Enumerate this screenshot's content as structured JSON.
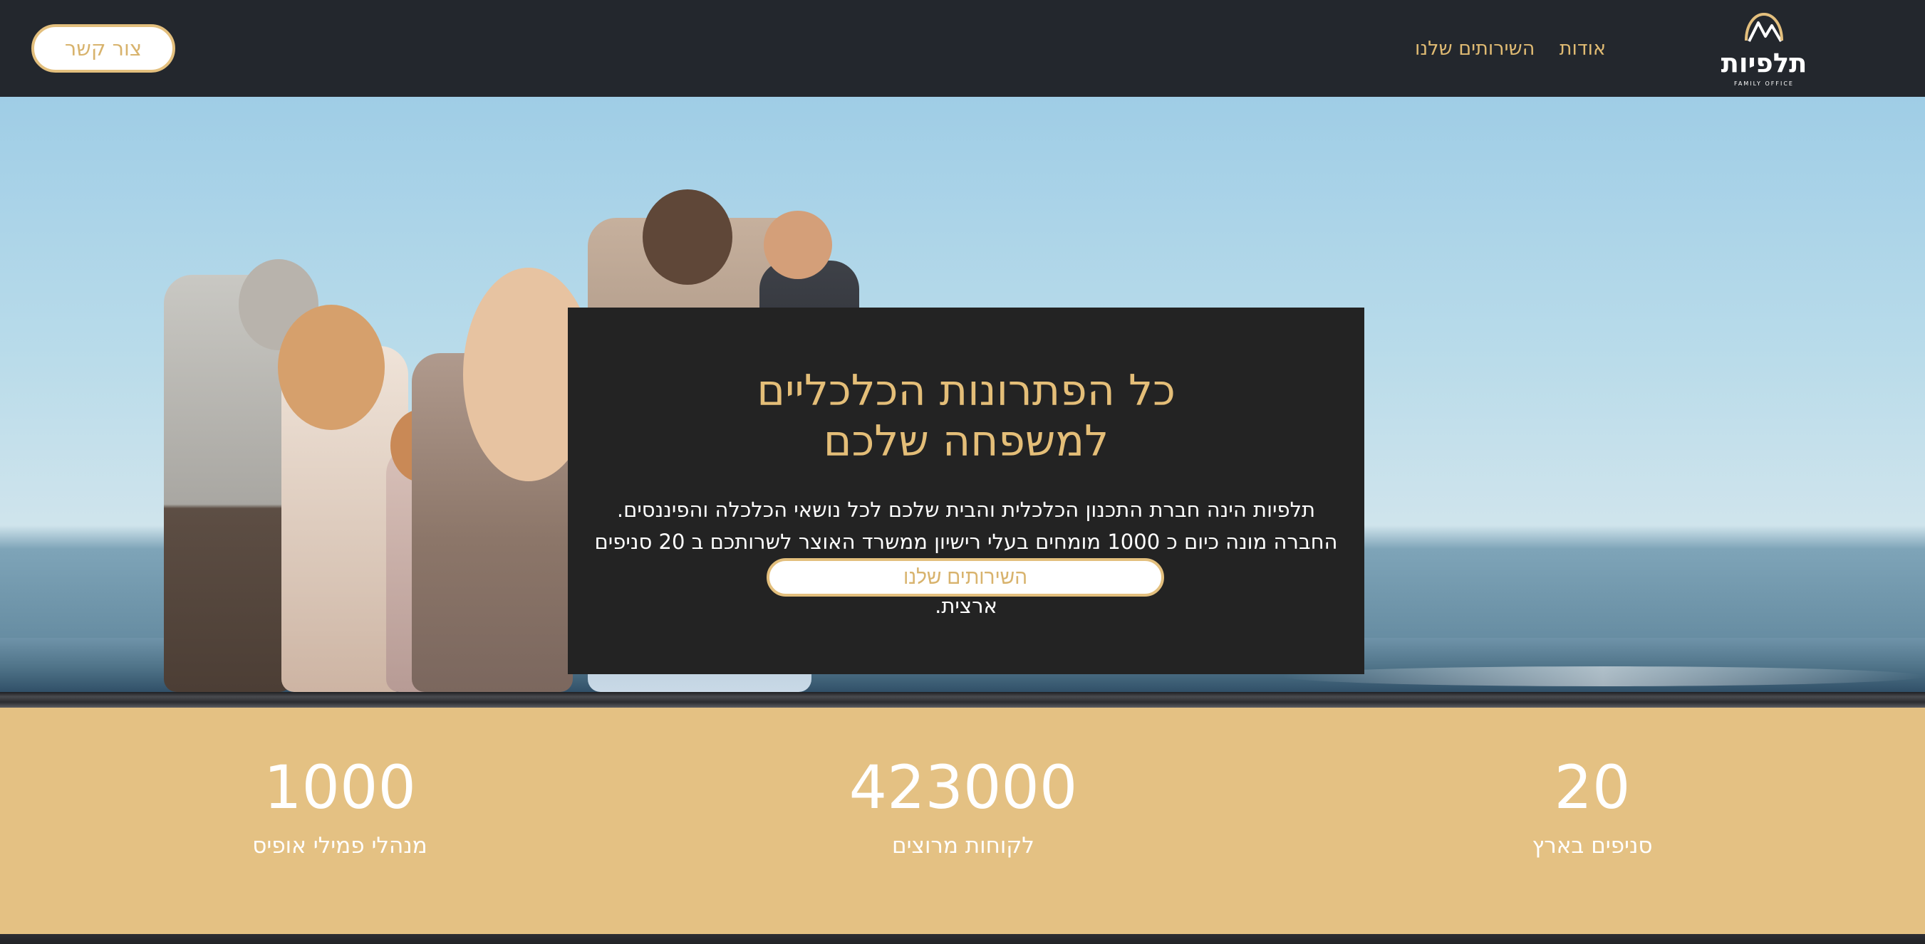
{
  "header": {
    "contact_button": "צור קשר",
    "nav": [
      {
        "label": "אודות"
      },
      {
        "label": "השירותים שלנו"
      }
    ],
    "logo": {
      "name": "תלפיות",
      "subtitle": "FAMILY OFFICE"
    }
  },
  "hero": {
    "headline_line1": "כל הפתרונות הכלכליים",
    "headline_line2": "למשפחה שלכם",
    "description_line1": "תלפיות הינה חברת התכנון הכלכלית והבית שלכם לכל נושאי הכלכלה והפיננסים.",
    "description_line2": "החברה מונה כיום כ 1000 מומחים בעלי רישיון ממשרד האוצר לשרותכם ב 20 סניפים בפריסה",
    "description_line3": "ארצית.",
    "button": "השירותים שלנו"
  },
  "stats": [
    {
      "value": "20",
      "label": "סניפים בארץ"
    },
    {
      "value": "423000",
      "label": "לקוחות מרוצים"
    },
    {
      "value": "1000",
      "label": "מנהלי פמילי אופיס"
    }
  ],
  "colors": {
    "header_bg": "#23272d",
    "accent": "#e3bf7d",
    "panel_bg": "#232323",
    "stats_bg": "#e4c183"
  },
  "icons": [
    "mountain-logo-icon"
  ]
}
